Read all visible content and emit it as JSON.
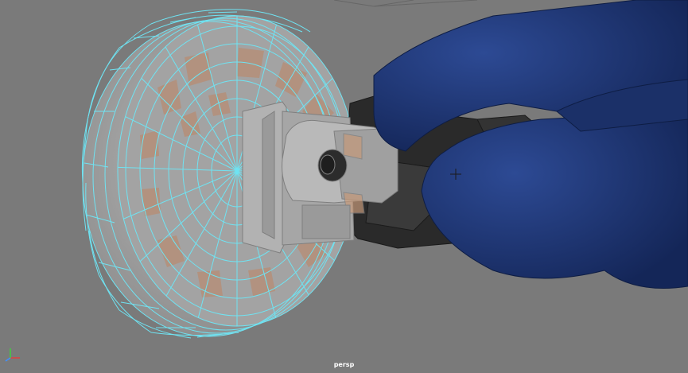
{
  "viewport": {
    "camera_name": "persp",
    "background_color": "#7a7a7a",
    "wireframe_color": "#6fe3f2",
    "selected_object": "wheel",
    "objects": [
      "wheel",
      "axle-bracket",
      "hand-sleeve"
    ]
  },
  "gizmo": {
    "axes": [
      "x",
      "y",
      "z"
    ],
    "colors": {
      "x": "#e04040",
      "y": "#40d040",
      "z": "#4090ff"
    }
  },
  "colors": {
    "tire": "#9c9c9c",
    "hub_highlight": "#b08f75",
    "bracket": "#a9a9a9",
    "sleeve": "#21397a",
    "tread": "#2a2a2a"
  }
}
